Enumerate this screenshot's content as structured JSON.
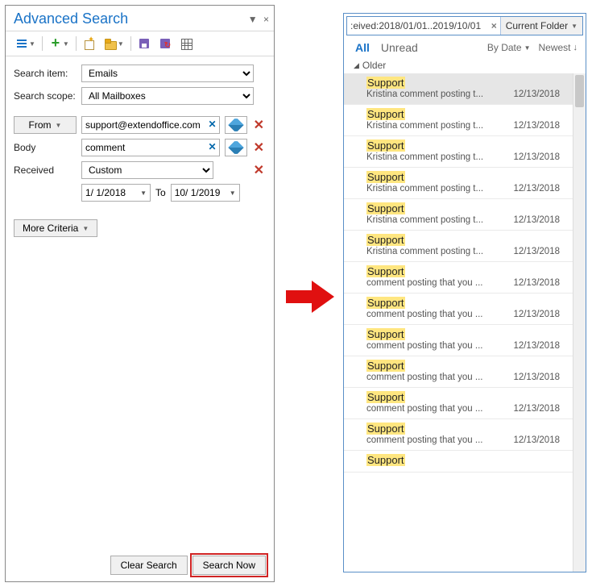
{
  "left": {
    "title": "Advanced Search",
    "toolbar": {},
    "labels": {
      "search_item": "Search item:",
      "search_scope": "Search scope:",
      "body": "Body",
      "received": "Received",
      "to_word": "To"
    },
    "search_item_value": "Emails",
    "search_scope_value": "All Mailboxes",
    "from_button": "From",
    "from_value": "support@extendoffice.com",
    "body_value": "comment",
    "received_value": "Custom",
    "date_from": "1/ 1/2018",
    "date_to": "10/ 1/2019",
    "more_criteria": "More Criteria",
    "clear_btn": "Clear Search",
    "search_btn": "Search Now"
  },
  "right": {
    "search_text": ":eived:2018/01/01..2019/10/01",
    "scope": "Current Folder",
    "tab_all": "All",
    "tab_unread": "Unread",
    "sort_by": "By Date",
    "sort_order": "Newest",
    "group": "Older",
    "items": [
      {
        "sender": "Support",
        "subject": "Kristina comment posting t...",
        "date": "12/13/2018",
        "selected": true
      },
      {
        "sender": "Support",
        "subject": "Kristina comment posting t...",
        "date": "12/13/2018"
      },
      {
        "sender": "Support",
        "subject": "Kristina comment posting t...",
        "date": "12/13/2018"
      },
      {
        "sender": "Support",
        "subject": "Kristina comment posting t...",
        "date": "12/13/2018"
      },
      {
        "sender": "Support",
        "subject": "Kristina comment posting t...",
        "date": "12/13/2018"
      },
      {
        "sender": "Support",
        "subject": "Kristina comment posting t...",
        "date": "12/13/2018"
      },
      {
        "sender": "Support",
        "subject": "comment posting that you ...",
        "date": "12/13/2018"
      },
      {
        "sender": "Support",
        "subject": "comment posting that you ...",
        "date": "12/13/2018"
      },
      {
        "sender": "Support",
        "subject": "comment posting that you ...",
        "date": "12/13/2018"
      },
      {
        "sender": "Support",
        "subject": "comment posting that you ...",
        "date": "12/13/2018"
      },
      {
        "sender": "Support",
        "subject": "comment posting that you ...",
        "date": "12/13/2018"
      },
      {
        "sender": "Support",
        "subject": "comment posting that you ...",
        "date": "12/13/2018"
      },
      {
        "sender": "Support",
        "subject": "",
        "date": ""
      }
    ]
  }
}
